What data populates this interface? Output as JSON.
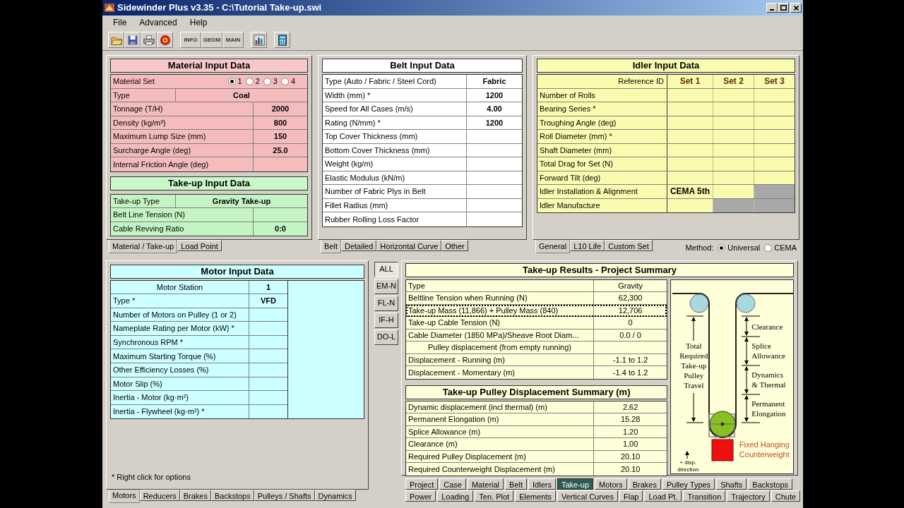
{
  "window": {
    "title": "Sidewinder Plus v3.35 - C:\\Tutorial Take-up.swi"
  },
  "menu": [
    "File",
    "Advanced",
    "Help"
  ],
  "toolbar": [
    [
      {
        "kind": "folder"
      },
      {
        "kind": "save"
      },
      {
        "kind": "print"
      },
      {
        "kind": "disc"
      }
    ],
    [
      {
        "kind": "labeled",
        "label": "INFO"
      },
      {
        "kind": "labeled",
        "label": "GEOM"
      },
      {
        "kind": "labeled",
        "label": "MAIN"
      }
    ],
    [
      {
        "kind": "chart"
      }
    ],
    [
      {
        "kind": "calculator"
      }
    ]
  ],
  "material": {
    "title": "Material Input Data",
    "set": {
      "label": "Material Set",
      "options": [
        {
          "label": "1",
          "selected": true
        },
        {
          "label": "2",
          "selected": false
        },
        {
          "label": "3",
          "selected": false
        },
        {
          "label": "4",
          "selected": false
        }
      ]
    },
    "rows": [
      {
        "label": "Type",
        "value": "Coal",
        "kind": "wide"
      },
      {
        "label": "Tonnage (T/H)",
        "value": "2000",
        "kind": "narrow"
      },
      {
        "label": "Density (kg/m³)",
        "value": "800",
        "kind": "narrow"
      },
      {
        "label": "Maximum Lump Size (mm)",
        "value": "150",
        "kind": "narrow"
      },
      {
        "label": "Surcharge Angle (deg)",
        "value": "25.0",
        "kind": "narrow"
      },
      {
        "label": "Internal Friction Angle (deg)",
        "kind": "narrow"
      }
    ]
  },
  "takeup_input": {
    "title": "Take-up Input Data",
    "rows": [
      {
        "label": "Take-up Type",
        "value": "Gravity Take-up",
        "kind": "wide"
      },
      {
        "label": "Belt Line Tension (N)",
        "kind": "narrow"
      },
      {
        "label": "Cable Revving Ratio",
        "value": "0:0",
        "kind": "narrow"
      }
    ]
  },
  "material_tabs": [
    {
      "label": "Material / Take-up",
      "selected": true
    },
    {
      "label": "Load Point",
      "selected": false
    }
  ],
  "belt": {
    "title": "Belt Input Data",
    "rows": [
      {
        "label": "Type (Auto / Fabric / Steel Cord)",
        "value": "Fabric"
      },
      {
        "label": "Width (mm) *",
        "value": "1200"
      },
      {
        "label": "Speed for All Cases (m/s)",
        "value": "4.00"
      },
      {
        "label": "Rating (N/mm) *",
        "value": "1200"
      },
      {
        "label": "Top Cover Thickness (mm)"
      },
      {
        "label": "Bottom Cover Thickness (mm)"
      },
      {
        "label": "Weight (kg/m)"
      },
      {
        "label": "Elastic Modulus (kN/m)"
      },
      {
        "label": "Number of Fabric Plys in Belt"
      },
      {
        "label": "Fillet Radius (mm)"
      },
      {
        "label": "Rubber Rolling Loss Factor"
      }
    ],
    "tabs": [
      {
        "label": "Belt",
        "selected": true
      },
      {
        "label": "Detailed",
        "selected": false
      },
      {
        "label": "Horizontal Curve",
        "selected": false
      },
      {
        "label": "Other",
        "selected": false
      }
    ]
  },
  "idler": {
    "title": "Idler Input Data",
    "reference_label": "Reference ID",
    "sets": [
      "Set 1",
      "Set 2",
      "Set 3"
    ],
    "rows": [
      {
        "label": "Number of Rolls",
        "cells": [
          {
            "disabled": false
          },
          {
            "disabled": false
          },
          {
            "disabled": false
          }
        ]
      },
      {
        "label": "Bearing Series *",
        "cells": [
          {
            "disabled": false
          },
          {
            "disabled": false
          },
          {
            "disabled": false
          }
        ]
      },
      {
        "label": "Troughing Angle (deg)",
        "cells": [
          {
            "disabled": false
          },
          {
            "disabled": false
          },
          {
            "disabled": false
          }
        ]
      },
      {
        "label": "Roll Diameter (mm) *",
        "cells": [
          {
            "disabled": false
          },
          {
            "disabled": false
          },
          {
            "disabled": false
          }
        ]
      },
      {
        "label": "Shaft Diameter (mm)",
        "cells": [
          {
            "disabled": false
          },
          {
            "disabled": false
          },
          {
            "disabled": false
          }
        ]
      },
      {
        "label": "Total Drag for Set (N)",
        "cells": [
          {
            "disabled": false
          },
          {
            "disabled": false
          },
          {
            "disabled": false
          }
        ]
      },
      {
        "label": "Forward Tilt (deg)",
        "cells": [
          {
            "disabled": false
          },
          {
            "disabled": false
          },
          {
            "disabled": false
          }
        ]
      },
      {
        "label": "Idler Installation & Alignment",
        "cells": [
          {
            "value": "CEMA 5th",
            "disabled": false
          },
          {
            "disabled": false
          },
          {
            "disabled": true
          }
        ]
      },
      {
        "label": "Idler Manufacture",
        "cells": [
          {
            "disabled": false
          },
          {
            "disabled": true
          },
          {
            "disabled": true
          }
        ]
      }
    ],
    "tabs": [
      {
        "label": "General",
        "selected": true
      },
      {
        "label": "L10 Life",
        "selected": false
      },
      {
        "label": "Custom Set",
        "selected": false
      }
    ],
    "method": {
      "label": "Method:",
      "options": [
        {
          "label": "Universal",
          "selected": true
        },
        {
          "label": "CEMA",
          "selected": false
        }
      ]
    }
  },
  "motor": {
    "title": "Motor Input Data",
    "station": {
      "label": "Motor Station",
      "value": "1"
    },
    "rows": [
      {
        "label": "Type *",
        "value": "VFD"
      },
      {
        "label": "Number of Motors on Pulley (1 or 2)"
      },
      {
        "label": "Nameplate Rating per Motor (kW) *"
      },
      {
        "label": "Synchronous RPM *"
      },
      {
        "label": "Maximum Starting Torque (%)"
      },
      {
        "label": "Other Efficiency Losses (%)"
      },
      {
        "label": "Motor Slip (%)"
      },
      {
        "label": "Inertia - Motor (kg·m²)"
      },
      {
        "label": "Inertia - Flywheel (kg·m²) *"
      }
    ],
    "note": "* Right click for options",
    "tabs": [
      {
        "label": "Motors",
        "selected": true
      },
      {
        "label": "Reducers",
        "selected": false
      },
      {
        "label": "Brakes",
        "selected": false
      },
      {
        "label": "Backstops",
        "selected": false
      },
      {
        "label": "Pulleys / Shafts",
        "selected": false
      },
      {
        "label": "Dynamics",
        "selected": false
      }
    ]
  },
  "case_buttons": [
    {
      "label": "ALL",
      "selected": true
    },
    {
      "label": "EM-N",
      "selected": false
    },
    {
      "label": "FL-N",
      "selected": false
    },
    {
      "label": "IF-H",
      "selected": false
    },
    {
      "label": "DO-L",
      "selected": false
    }
  ],
  "results": {
    "title": "Take-up Results - Project Summary",
    "rows": [
      {
        "label": "Type",
        "value": "Gravity",
        "kind": "row",
        "focused": false
      },
      {
        "label": "Beltline Tension when Running (N)",
        "value": "62,300",
        "kind": "row",
        "focused": false
      },
      {
        "label": "Take-up Mass (11,866) + Pulley Mass (840)",
        "value": "12,706",
        "kind": "row",
        "focused": true
      },
      {
        "label": "Take-up Cable Tension (N)",
        "value": "0",
        "kind": "row",
        "focused": false
      },
      {
        "label": "Cable Diameter (1850 MPa)/Sheave Root Diam...",
        "value": "0.0 / 0",
        "kind": "row",
        "focused": false
      },
      {
        "label": "Pulley displacement (from empty running)",
        "kind": "heading",
        "focused": false
      },
      {
        "label": "Displacement - Running (m)",
        "value": "-1.1 to 1.2",
        "kind": "row",
        "focused": false
      },
      {
        "label": "Displacement - Momentary (m)",
        "value": "-1.4 to 1.2",
        "kind": "row",
        "focused": false
      }
    ]
  },
  "displacement": {
    "title": "Take-up Pulley Displacement Summary (m)",
    "rows": [
      {
        "label": "Dynamic displacement (incl thermal) (m)",
        "value": "2.62"
      },
      {
        "label": "Permanent Elongation (m)",
        "value": "15.28"
      },
      {
        "label": "Splice Allowance (m)",
        "value": "1.20"
      },
      {
        "label": "Clearance (m)",
        "value": "1.00"
      },
      {
        "label": "Required Pulley Displacement (m)",
        "value": "20.10"
      },
      {
        "label": "Required Counterweight Displacement (m)",
        "value": "20.10"
      }
    ]
  },
  "diagram": {
    "labels": [
      {
        "kind": "travel",
        "text": "Total Required Take-up Pulley Travel"
      },
      {
        "kind": "clearance",
        "text": "Clearance"
      },
      {
        "kind": "splice",
        "text": "Splice Allowance"
      },
      {
        "kind": "dynamics",
        "text": "Dynamics & Thermal"
      },
      {
        "kind": "elongation",
        "text": "Permanent Elongation"
      },
      {
        "kind": "direction",
        "text": "+ disp. direction"
      },
      {
        "kind": "counterweight",
        "text": "Fixed Hanging Counterweight"
      }
    ]
  },
  "bottom_tabs": [
    [
      {
        "label": "Project",
        "selected": false
      },
      {
        "label": "Case",
        "selected": false
      },
      {
        "label": "Material",
        "selected": false
      },
      {
        "label": "Belt",
        "selected": false
      },
      {
        "label": "Idlers",
        "selected": false
      },
      {
        "label": "Take-up",
        "selected": true
      },
      {
        "label": "Motors",
        "selected": false
      },
      {
        "label": "Brakes",
        "selected": false
      },
      {
        "label": "Pulley Types",
        "selected": false
      },
      {
        "label": "Shafts",
        "selected": false
      },
      {
        "label": "Backstops",
        "selected": false
      }
    ],
    [
      {
        "label": "Power",
        "selected": false
      },
      {
        "label": "Loading",
        "selected": false
      },
      {
        "label": "Ten. Plot",
        "selected": false
      },
      {
        "label": "Elements",
        "selected": false
      },
      {
        "label": "Vertical Curves",
        "selected": false
      },
      {
        "label": "Flap",
        "selected": false
      },
      {
        "label": "Load Pt.",
        "selected": false
      },
      {
        "label": "Transition",
        "selected": false
      },
      {
        "label": "Trajectory",
        "selected": false
      },
      {
        "label": "Chute",
        "selected": false
      }
    ]
  ]
}
